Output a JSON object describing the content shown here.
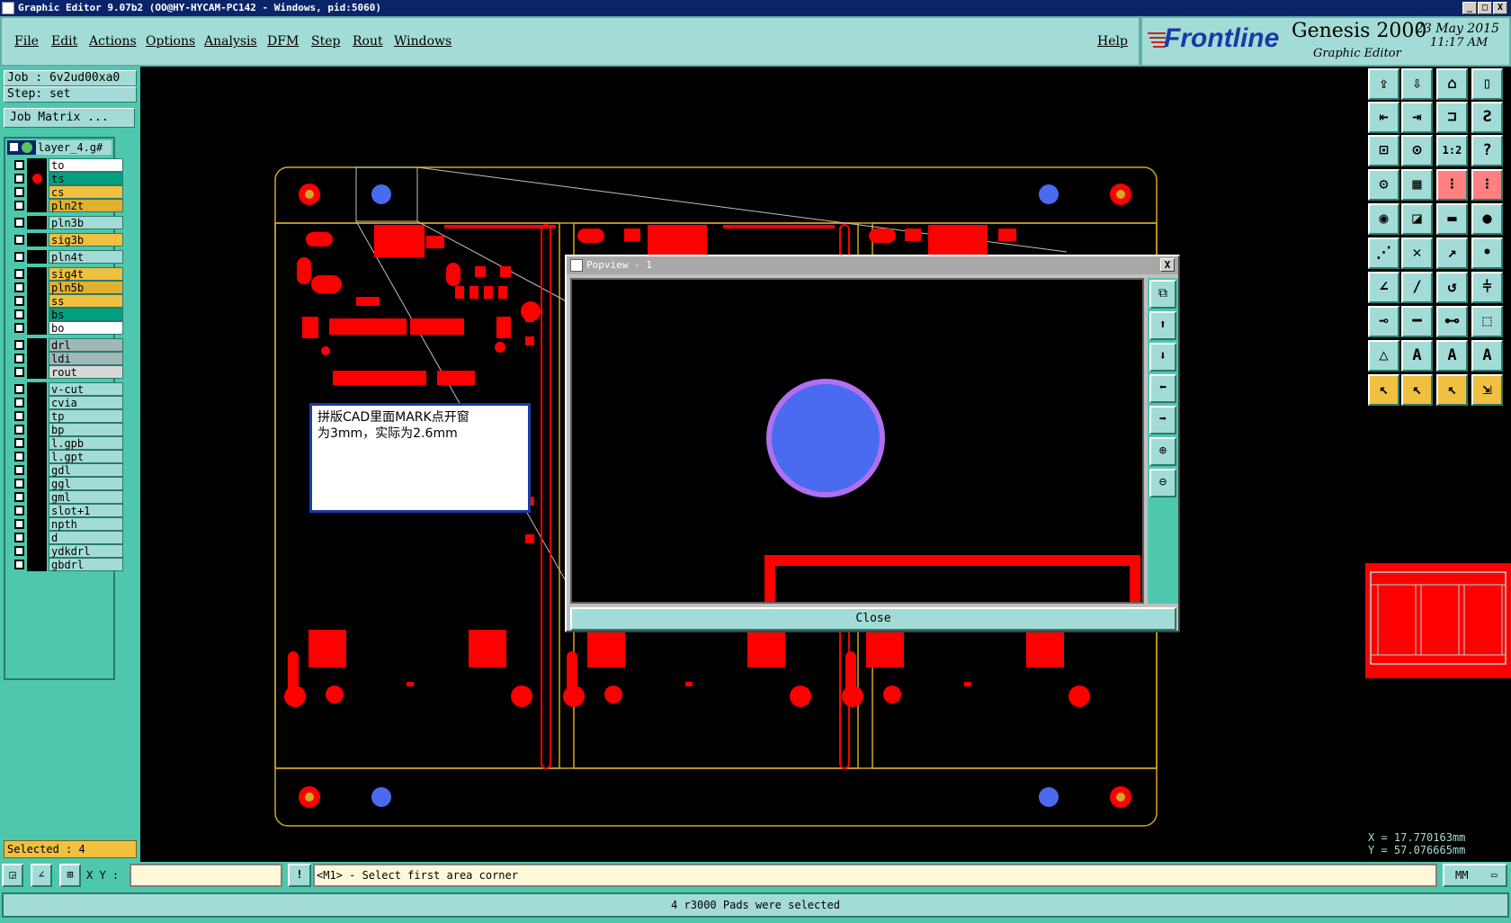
{
  "titlebar": {
    "text": "Graphic Editor 9.07b2 (OO@HY-HYCAM-PC142 - Windows, pid:5060)",
    "min": "_",
    "max": "□",
    "close": "X"
  },
  "menu": {
    "items": [
      "File",
      "Edit",
      "Actions",
      "Options",
      "Analysis",
      "DFM",
      "Step",
      "Rout",
      "Windows"
    ],
    "help": "Help"
  },
  "brand": {
    "logo": "Frontline",
    "product": "Genesis 2000",
    "subtitle": "Graphic Editor",
    "date": "23 May 2015",
    "time": "11:17 AM"
  },
  "job": {
    "job_label": "Job  :  6v2ud00xa0",
    "step_label": "Step:  set",
    "matrix_button": "Job Matrix ..."
  },
  "layers": {
    "header": "layer_4.g#",
    "groups": [
      [
        {
          "name": "to",
          "color": "#ffffff",
          "dot": false
        },
        {
          "name": "ts",
          "color": "#00a080",
          "dot": true
        },
        {
          "name": "cs",
          "color": "#f0c040",
          "dot": false
        },
        {
          "name": "pln2t",
          "color": "#e0b030",
          "dot": false
        }
      ],
      [
        {
          "name": "pln3b",
          "color": "#a3dcd6",
          "dot": false
        }
      ],
      [
        {
          "name": "sig3b",
          "color": "#f0c040",
          "dot": false
        }
      ],
      [
        {
          "name": "pln4t",
          "color": "#a3dcd6",
          "dot": false
        }
      ],
      [
        {
          "name": "sig4t",
          "color": "#f0c040",
          "dot": false
        },
        {
          "name": "pln5b",
          "color": "#e0b030",
          "dot": false
        },
        {
          "name": "ss",
          "color": "#f0c040",
          "dot": false
        },
        {
          "name": "bs",
          "color": "#00a080",
          "dot": false
        },
        {
          "name": "bo",
          "color": "#ffffff",
          "dot": false
        }
      ],
      [
        {
          "name": "drl",
          "color": "#a0b8b8",
          "dot": false
        },
        {
          "name": "ldi",
          "color": "#a0b8b8",
          "dot": false
        },
        {
          "name": "rout",
          "color": "#d8d8d8",
          "dot": false
        }
      ],
      [
        {
          "name": "v-cut",
          "color": "#a3dcd6",
          "dot": false
        },
        {
          "name": "cvia",
          "color": "#a3dcd6",
          "dot": false
        },
        {
          "name": "tp",
          "color": "#a3dcd6",
          "dot": false
        },
        {
          "name": "bp",
          "color": "#a3dcd6",
          "dot": false
        },
        {
          "name": "l.gpb",
          "color": "#a3dcd6",
          "dot": false
        },
        {
          "name": "l.gpt",
          "color": "#a3dcd6",
          "dot": false
        },
        {
          "name": "gdl",
          "color": "#a3dcd6",
          "dot": false
        },
        {
          "name": "ggl",
          "color": "#a3dcd6",
          "dot": false
        },
        {
          "name": "gml",
          "color": "#a3dcd6",
          "dot": false
        },
        {
          "name": "slot+1",
          "color": "#a3dcd6",
          "dot": false
        },
        {
          "name": "npth",
          "color": "#a3dcd6",
          "dot": false
        },
        {
          "name": "d",
          "color": "#a3dcd6",
          "dot": false
        },
        {
          "name": "ydkdrl",
          "color": "#a3dcd6",
          "dot": false
        },
        {
          "name": "gbdrl",
          "color": "#a3dcd6",
          "dot": false
        }
      ]
    ]
  },
  "selected": "Selected : 4",
  "annotation": {
    "line1": "拼版CAD里面MARK点开窗",
    "line2": "为3mm，实际为2.6mm"
  },
  "popview": {
    "title": "Popview - 1",
    "close_label": "Close",
    "close_x": "X"
  },
  "coords": {
    "x": "X  =  17.770163mm",
    "y": "Y  =  57.076665mm"
  },
  "bottom": {
    "xy_label": "X Y :",
    "xy_value": "",
    "prompt": "<M1> - Select first area corner",
    "units": "MM",
    "info_marker": "!",
    "status": "4 r3000 Pads were selected"
  },
  "colors": {
    "accent": "#a3dcd6",
    "panel": "#4ec8ac",
    "pad_red": "#ff0000",
    "mark_blue": "#4a6af0",
    "outline_gold": "#d4a820",
    "ring_purple": "#b070f0"
  }
}
